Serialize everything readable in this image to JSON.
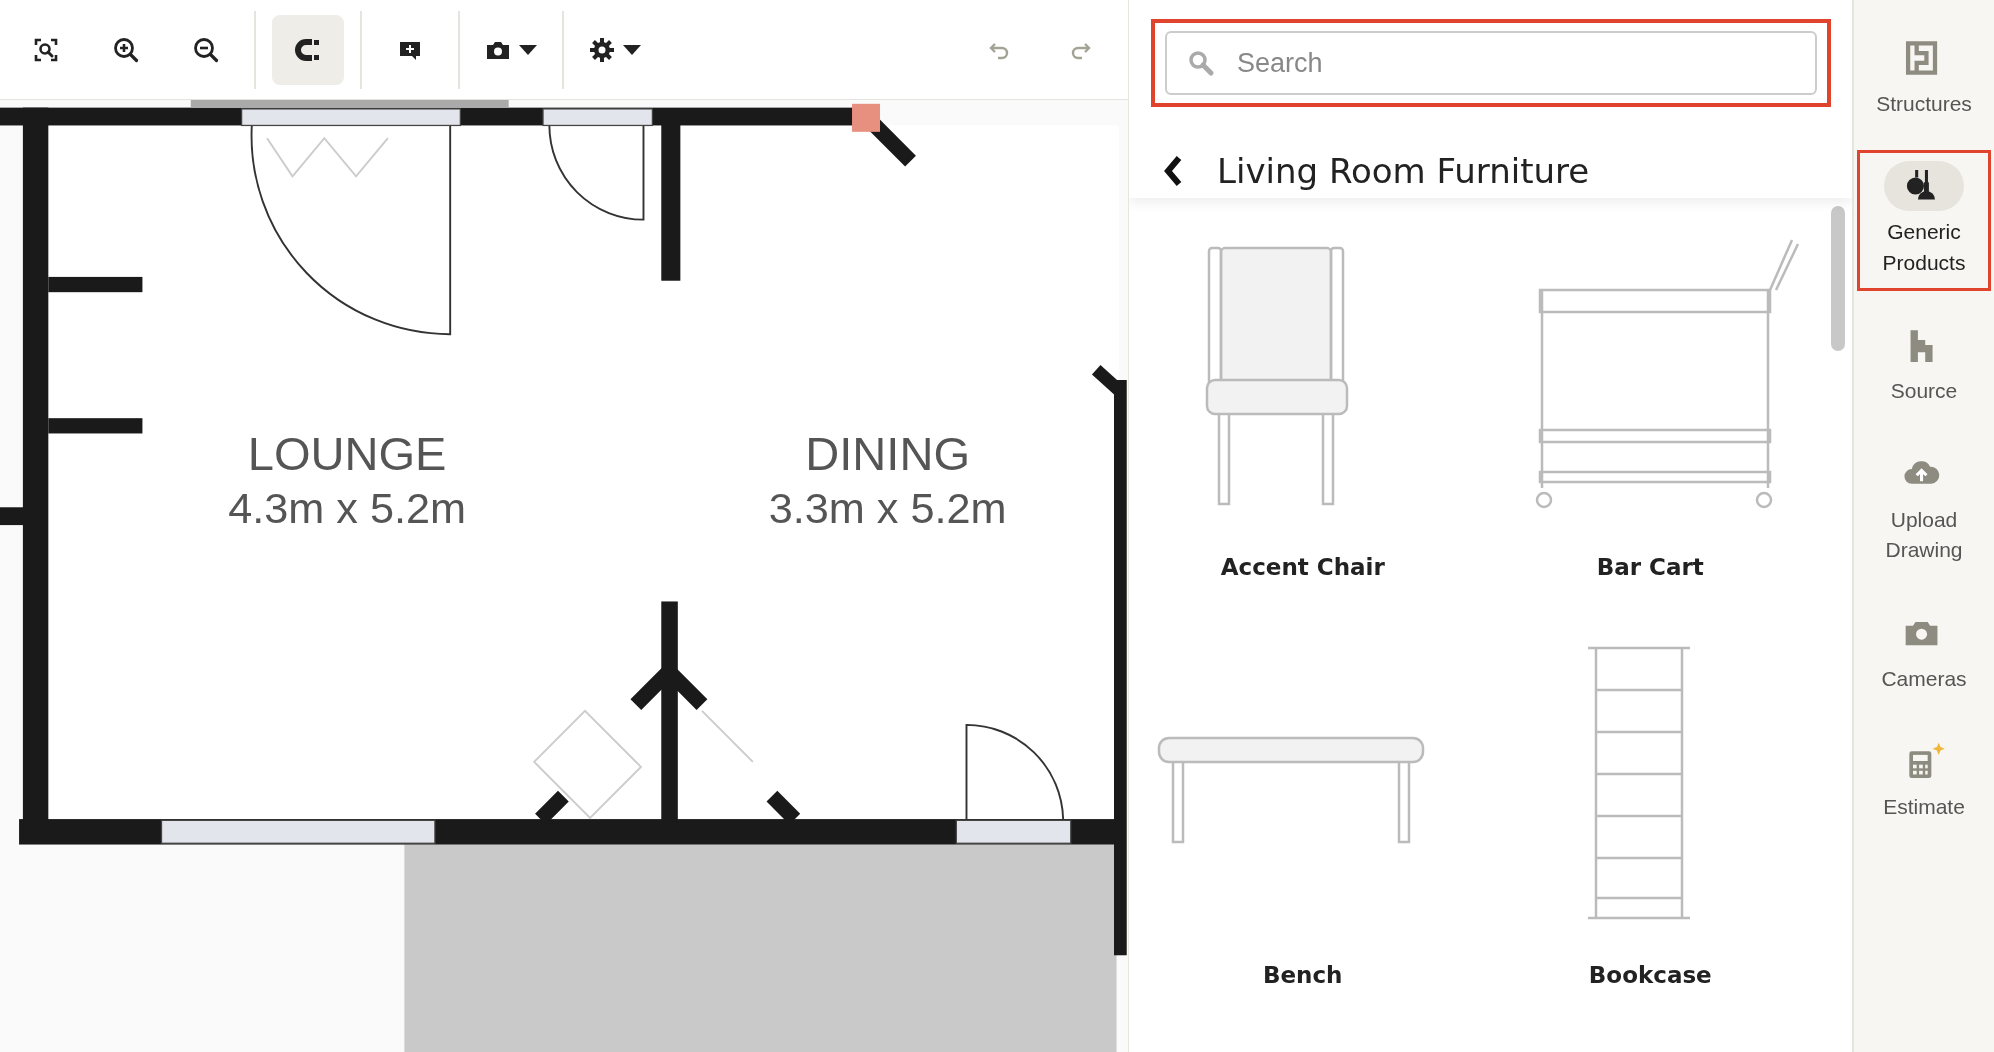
{
  "toolbar": {
    "tools": [
      {
        "kind": "fit",
        "active": false,
        "disabled": false
      },
      {
        "kind": "zoomin",
        "active": false,
        "disabled": false
      },
      {
        "kind": "zoomout",
        "active": false,
        "disabled": false
      },
      {
        "kind": "snap",
        "active": true,
        "disabled": false
      },
      {
        "kind": "note",
        "active": false,
        "disabled": false
      },
      {
        "kind": "camera",
        "active": false,
        "disabled": false
      },
      {
        "kind": "settings",
        "active": false,
        "disabled": false
      },
      {
        "kind": "undo",
        "active": false,
        "disabled": true
      },
      {
        "kind": "redo",
        "active": false,
        "disabled": true
      }
    ]
  },
  "floor_plan": {
    "rooms": [
      {
        "name": "LOUNGE",
        "size": "4.3m x 5.2m"
      },
      {
        "name": "DINING",
        "size": "3.3m x 5.2m"
      }
    ]
  },
  "panel": {
    "search": {
      "placeholder": "Search",
      "highlighted": true
    },
    "title": "Living Room Furniture",
    "products": [
      {
        "name": "Accent Chair",
        "kind": "chair"
      },
      {
        "name": "Bar Cart",
        "kind": "cart"
      },
      {
        "name": "Bench",
        "kind": "bench"
      },
      {
        "name": "Bookcase",
        "kind": "shelf"
      }
    ]
  },
  "sidebar": {
    "items": [
      {
        "label": "Structures",
        "kind": "structures",
        "selected": false,
        "highlighted": false
      },
      {
        "label": "Generic Products",
        "kind": "products",
        "selected": true,
        "highlighted": true
      },
      {
        "label": "Source",
        "kind": "source",
        "selected": false,
        "highlighted": false
      },
      {
        "label": "Upload Drawing",
        "kind": "upload",
        "selected": false,
        "highlighted": false
      },
      {
        "label": "Cameras",
        "kind": "cameras",
        "selected": false,
        "highlighted": false
      },
      {
        "label": "Estimate",
        "kind": "estimate",
        "selected": false,
        "highlighted": false
      }
    ]
  }
}
